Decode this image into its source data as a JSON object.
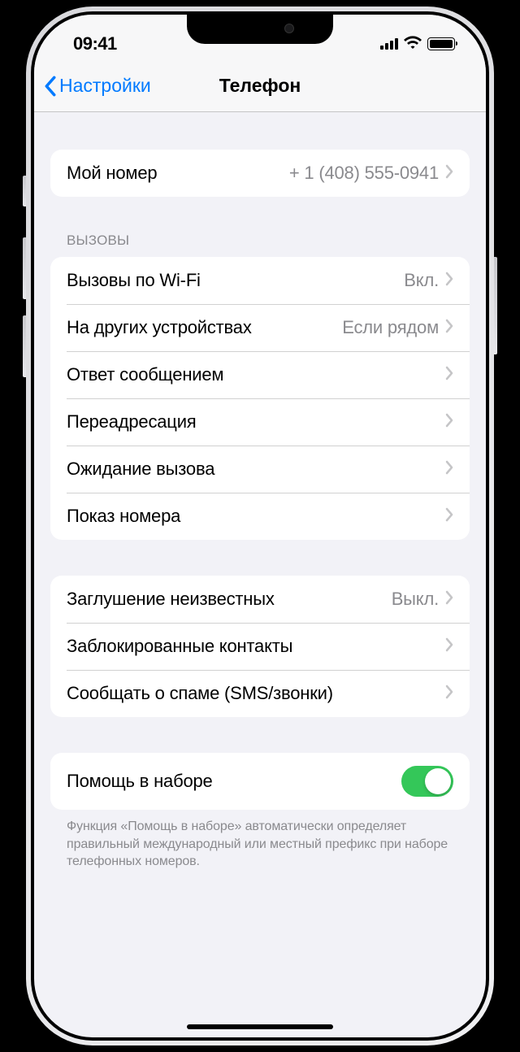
{
  "status": {
    "time": "09:41"
  },
  "nav": {
    "back": "Настройки",
    "title": "Телефон"
  },
  "groups": {
    "my_number": {
      "label": "Мой номер",
      "value": "+ 1 (408) 555-0941"
    },
    "calls": {
      "header": "ВЫЗОВЫ",
      "items": [
        {
          "label": "Вызовы по Wi-Fi",
          "value": "Вкл."
        },
        {
          "label": "На других устройствах",
          "value": "Если рядом"
        },
        {
          "label": "Ответ сообщением",
          "value": ""
        },
        {
          "label": "Переадресация",
          "value": ""
        },
        {
          "label": "Ожидание вызова",
          "value": ""
        },
        {
          "label": "Показ номера",
          "value": ""
        }
      ]
    },
    "block": {
      "items": [
        {
          "label": "Заглушение неизвестных",
          "value": "Выкл."
        },
        {
          "label": "Заблокированные контакты",
          "value": ""
        },
        {
          "label": "Сообщать о спаме (SMS/звонки)",
          "value": ""
        }
      ]
    },
    "dial_assist": {
      "label": "Помощь в наборе",
      "enabled": true,
      "footer": "Функция «Помощь в наборе» автоматически определяет правильный международный или местный префикс при наборе телефонных номеров."
    }
  }
}
